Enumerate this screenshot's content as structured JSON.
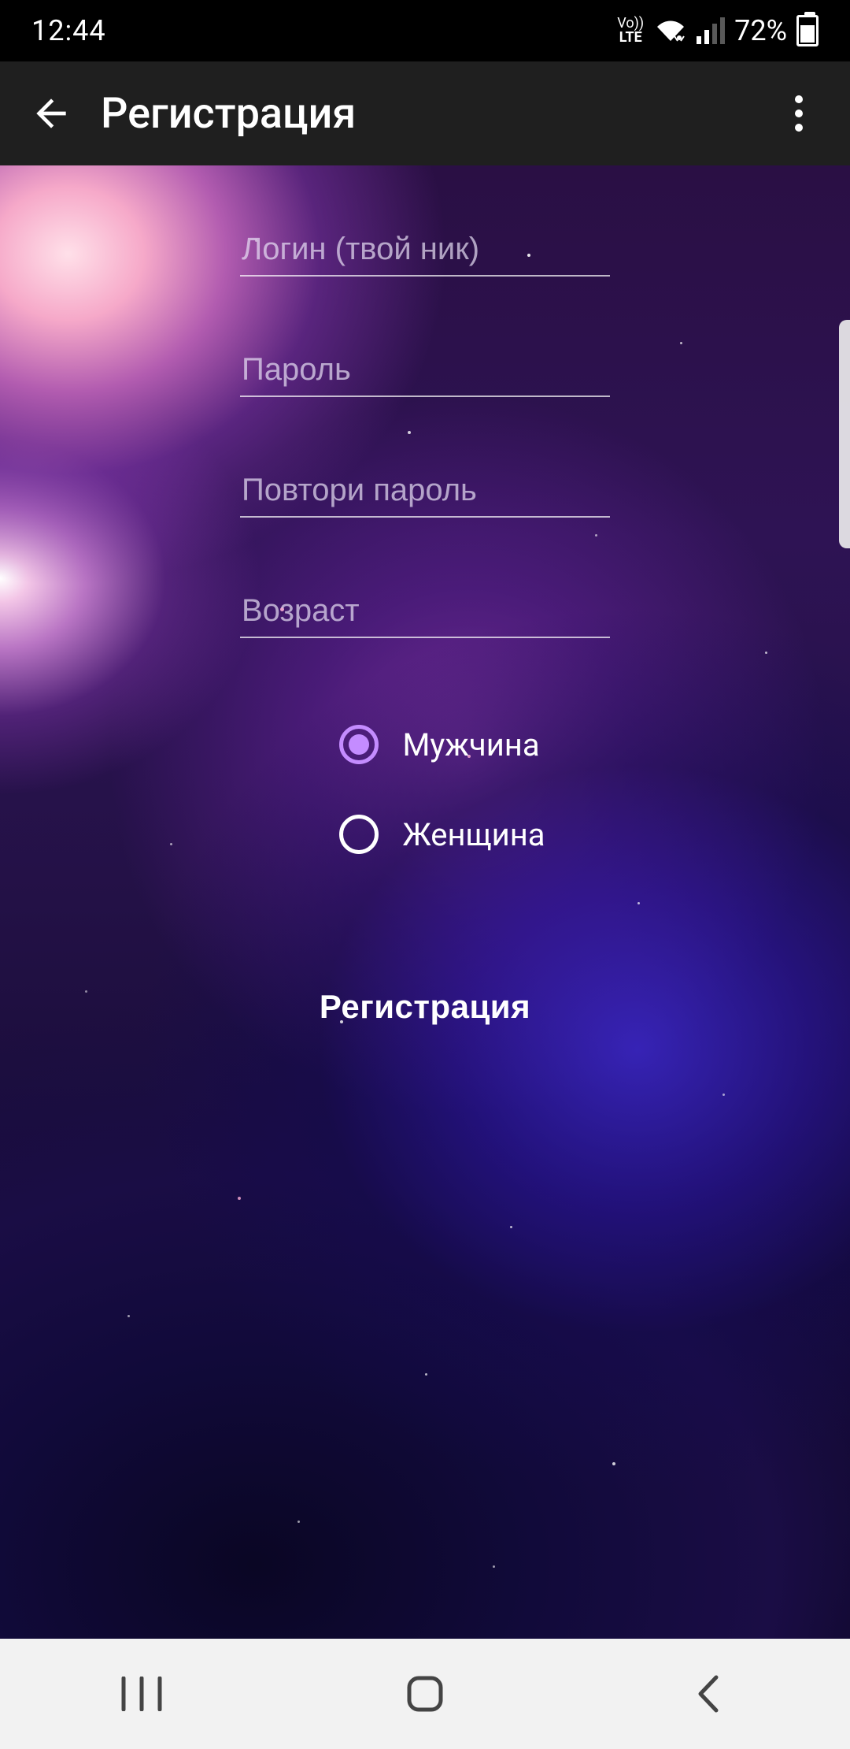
{
  "status": {
    "time": "12:44",
    "battery_percent": "72%",
    "volte_top": "Vo))",
    "volte_bot": "LTE"
  },
  "header": {
    "title": "Регистрация"
  },
  "form": {
    "login_placeholder": "Логин (твой ник)",
    "password_placeholder": "Пароль",
    "repeat_password_placeholder": "Повтори пароль",
    "age_placeholder": "Возраст",
    "gender": {
      "male_label": "Мужчина",
      "female_label": "Женщина",
      "selected": "male"
    },
    "submit_label": "Регистрация"
  },
  "colors": {
    "accent": "#c48cff"
  }
}
